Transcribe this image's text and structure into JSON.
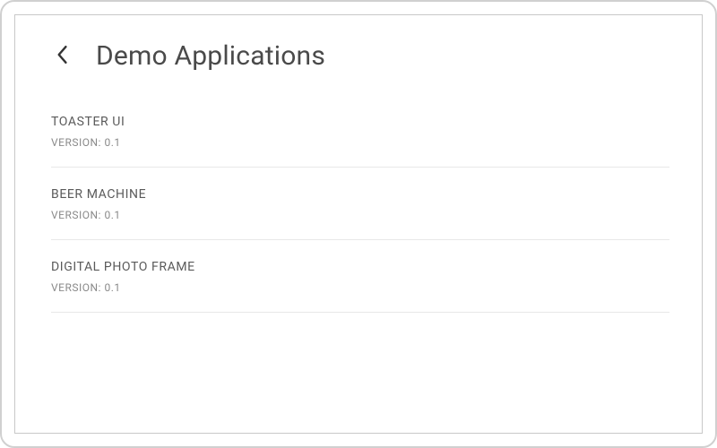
{
  "header": {
    "title": "Demo Applications"
  },
  "apps": [
    {
      "name": "TOASTER UI",
      "version": "VERSION: 0.1"
    },
    {
      "name": "BEER MACHINE",
      "version": "VERSION: 0.1"
    },
    {
      "name": "DIGITAL PHOTO FRAME",
      "version": "VERSION: 0.1"
    }
  ]
}
